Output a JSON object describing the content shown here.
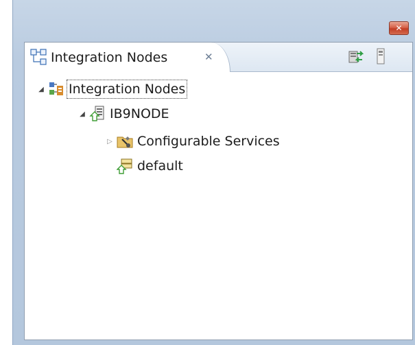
{
  "window": {
    "close_glyph": "✕"
  },
  "view": {
    "tab_label": "Integration Nodes",
    "tab_close_glyph": "✕",
    "toolbar": {
      "connect_icon": "connect-nodes-icon",
      "menu_icon": "view-menu-icon"
    }
  },
  "tree": {
    "root": {
      "label": "Integration Nodes",
      "expanded": true,
      "icon": "integration-nodes-icon"
    },
    "node": {
      "label": "IB9NODE",
      "expanded": true,
      "icon": "integration-node-icon"
    },
    "services": {
      "label": "Configurable Services",
      "expanded": false,
      "icon": "configurable-services-icon"
    },
    "server": {
      "label": "default",
      "icon": "integration-server-icon"
    }
  },
  "colors": {
    "frame": "#b4c7dd",
    "close_button": "#c94a32",
    "folder": "#e9c46a",
    "node_green": "#4b9a3c"
  }
}
